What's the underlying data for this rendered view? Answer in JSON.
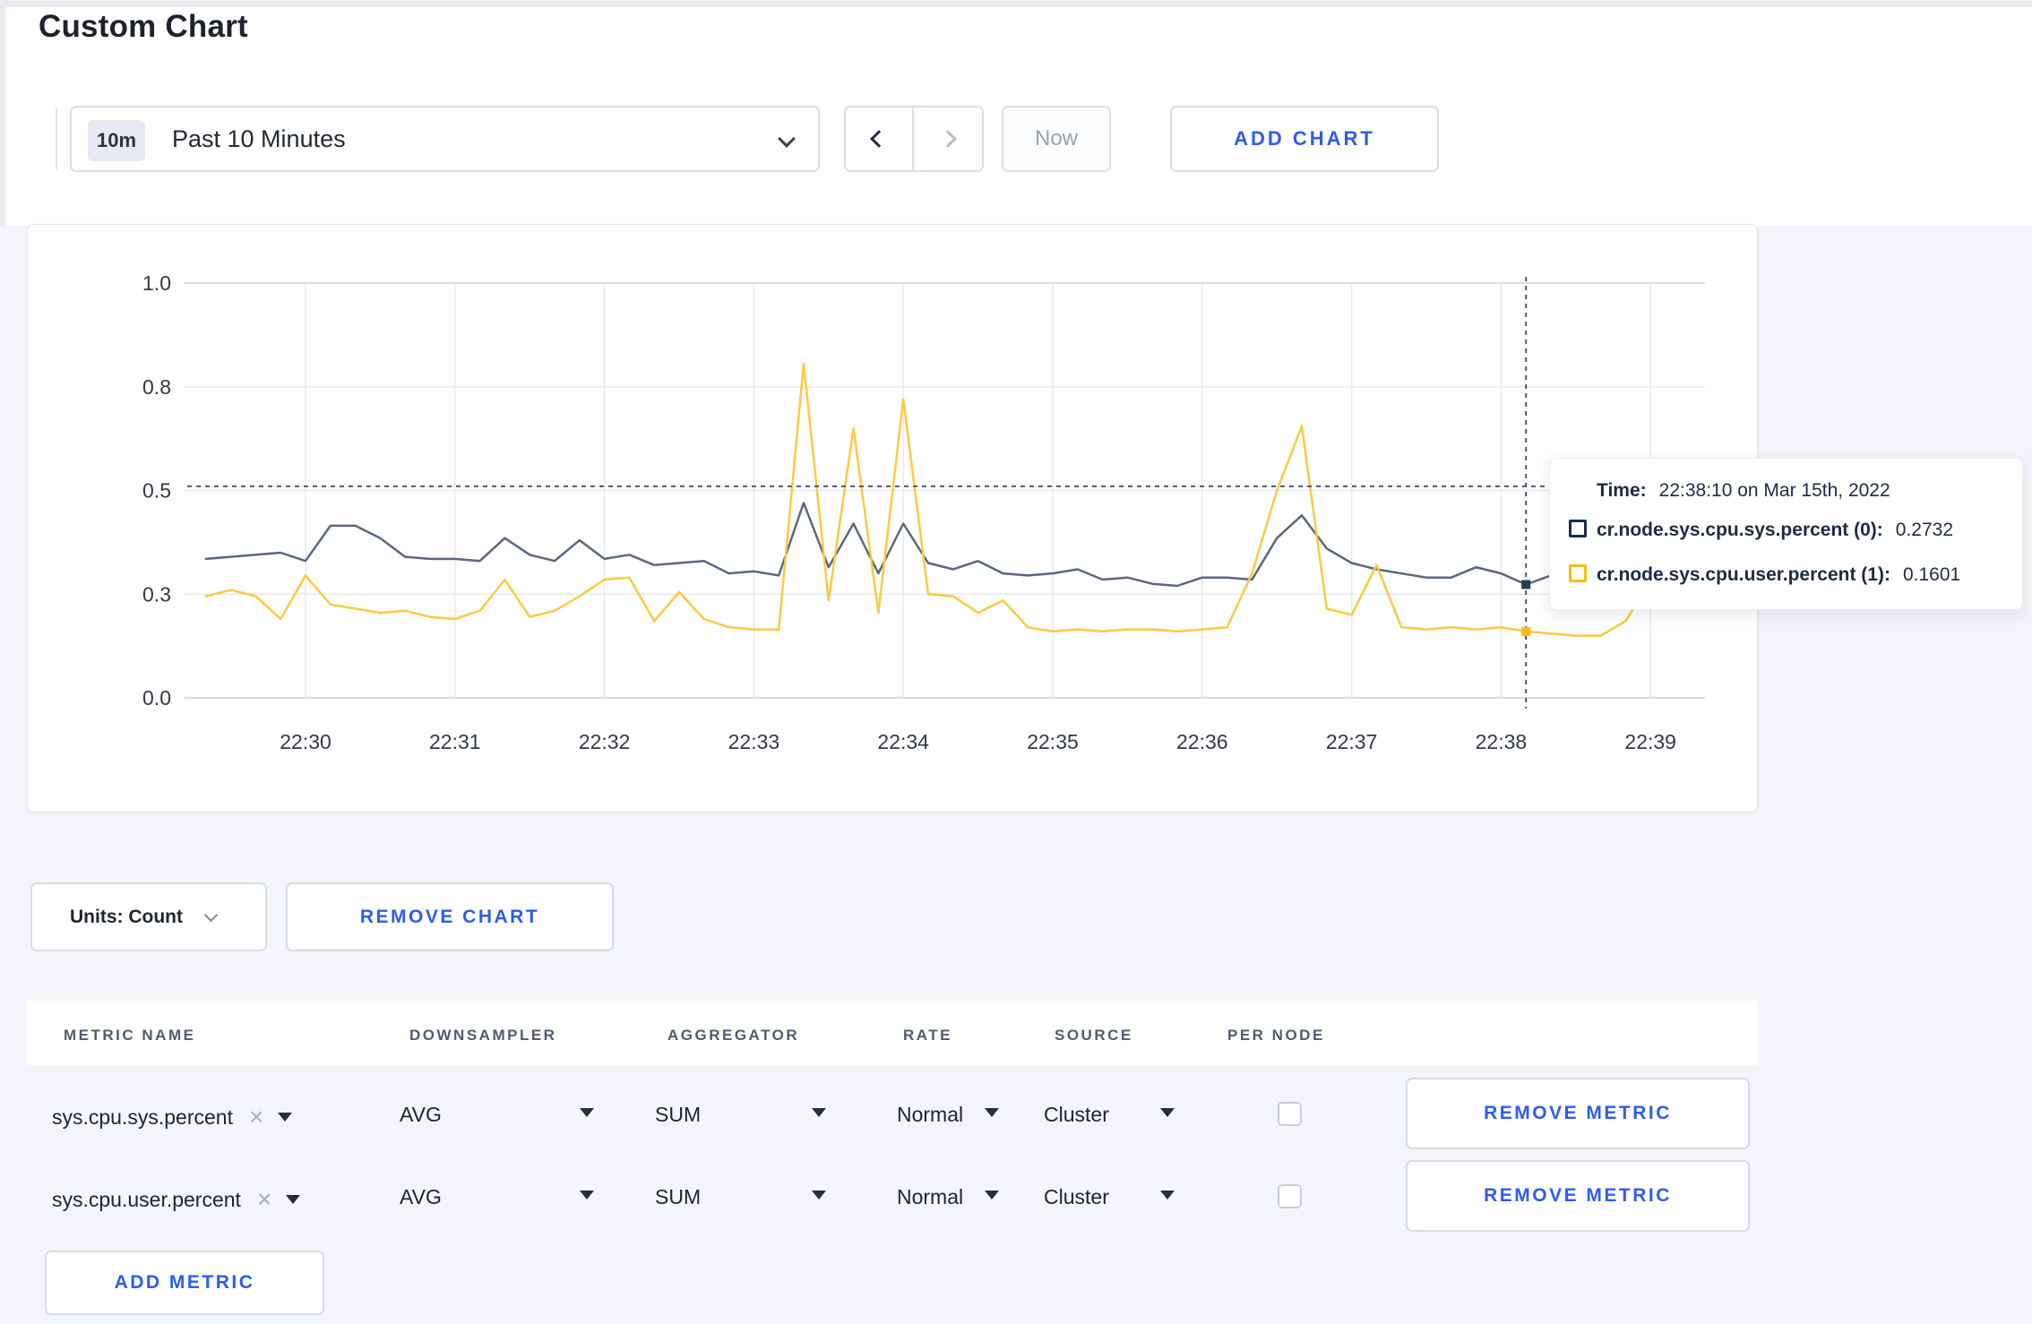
{
  "page": {
    "title": "Custom Chart"
  },
  "toolbar": {
    "time_range": {
      "badge": "10m",
      "label": "Past 10 Minutes"
    },
    "now_label": "Now",
    "add_chart_label": "ADD CHART"
  },
  "tooltip": {
    "time_label": "Time:",
    "time_value": "22:38:10 on Mar 15th, 2022",
    "series": [
      {
        "label": "cr.node.sys.cpu.sys.percent (0):",
        "value": "0.2732",
        "color": "#1b2b4e"
      },
      {
        "label": "cr.node.sys.cpu.user.percent (1):",
        "value": "0.1601",
        "color": "#fdbd10"
      }
    ]
  },
  "chart_actions": {
    "units_label": "Units: Count",
    "remove_chart_label": "REMOVE CHART"
  },
  "metrics_table": {
    "headers": [
      "METRIC NAME",
      "DOWNSAMPLER",
      "AGGREGATOR",
      "RATE",
      "SOURCE",
      "PER NODE"
    ],
    "rows": [
      {
        "metric": "sys.cpu.sys.percent",
        "downsampler": "AVG",
        "aggregator": "SUM",
        "rate": "Normal",
        "source": "Cluster",
        "per_node_checked": false,
        "remove_label": "REMOVE METRIC"
      },
      {
        "metric": "sys.cpu.user.percent",
        "downsampler": "AVG",
        "aggregator": "SUM",
        "rate": "Normal",
        "source": "Cluster",
        "per_node_checked": false,
        "remove_label": "REMOVE METRIC"
      }
    ],
    "add_metric_label": "ADD METRIC"
  },
  "chart_data": {
    "type": "line",
    "x_start": "22:29:20",
    "x_interval_seconds": 10,
    "x_tick_labels": [
      "22:30",
      "22:31",
      "22:32",
      "22:33",
      "22:34",
      "22:35",
      "22:36",
      "22:37",
      "22:38",
      "22:39"
    ],
    "x_tick_indices": [
      4,
      10,
      16,
      22,
      28,
      34,
      40,
      46,
      52,
      58
    ],
    "y_tick_labels": [
      "0.0",
      "0.3",
      "0.5",
      "0.8",
      "1.0"
    ],
    "y_tick_values": [
      0,
      0.25,
      0.5,
      0.75,
      1.0
    ],
    "ylim": [
      0,
      1
    ],
    "grid": true,
    "legend_position": "tooltip",
    "series": [
      {
        "name": "cr.node.sys.cpu.sys.percent",
        "color": "#5a6780",
        "dot_color": "#2c3b58",
        "values": [
          0.335,
          0.34,
          0.345,
          0.35,
          0.33,
          0.415,
          0.415,
          0.385,
          0.34,
          0.335,
          0.335,
          0.33,
          0.385,
          0.345,
          0.33,
          0.38,
          0.335,
          0.345,
          0.32,
          0.325,
          0.33,
          0.3,
          0.305,
          0.295,
          0.47,
          0.315,
          0.42,
          0.3,
          0.42,
          0.325,
          0.31,
          0.33,
          0.3,
          0.295,
          0.3,
          0.31,
          0.285,
          0.29,
          0.275,
          0.27,
          0.29,
          0.29,
          0.285,
          0.385,
          0.44,
          0.36,
          0.325,
          0.31,
          0.3,
          0.29,
          0.29,
          0.315,
          0.3,
          0.2732,
          0.295,
          0.3,
          0.31,
          0.3,
          0.3,
          0.315,
          0.305
        ]
      },
      {
        "name": "cr.node.sys.cpu.user.percent",
        "color": "#ffc940",
        "dot_color": "#fdbd10",
        "values": [
          0.245,
          0.26,
          0.245,
          0.19,
          0.295,
          0.225,
          0.215,
          0.205,
          0.21,
          0.195,
          0.19,
          0.21,
          0.285,
          0.195,
          0.21,
          0.245,
          0.285,
          0.29,
          0.185,
          0.255,
          0.19,
          0.17,
          0.165,
          0.165,
          0.805,
          0.235,
          0.65,
          0.205,
          0.72,
          0.25,
          0.245,
          0.205,
          0.235,
          0.17,
          0.16,
          0.165,
          0.16,
          0.165,
          0.165,
          0.16,
          0.165,
          0.17,
          0.3,
          0.5,
          0.655,
          0.215,
          0.2,
          0.32,
          0.17,
          0.165,
          0.17,
          0.165,
          0.17,
          0.1601,
          0.155,
          0.15,
          0.15,
          0.185,
          0.28,
          0.3,
          0.235
        ]
      }
    ],
    "crosshair": {
      "time_index": 53,
      "time_label": "22:38:10",
      "mouse_y_value": 0.51
    }
  }
}
